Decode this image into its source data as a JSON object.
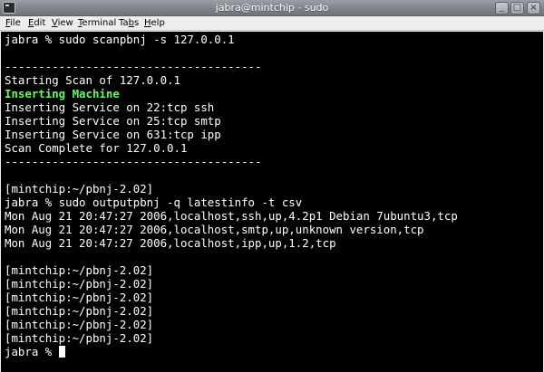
{
  "window": {
    "title": "jabra@mintchip - sudo"
  },
  "titlebar_buttons": {
    "minimize": "_",
    "maximize": "□",
    "close": "×"
  },
  "menubar": {
    "items": [
      {
        "accel": "F",
        "rest": "ile"
      },
      {
        "accel": "E",
        "rest": "dit"
      },
      {
        "accel": "V",
        "rest": "iew"
      },
      {
        "accel": "T",
        "rest": "erminal"
      },
      {
        "pre": "Ta",
        "accel": "b",
        "rest": "s"
      },
      {
        "accel": "H",
        "rest": "elp"
      }
    ]
  },
  "terminal": {
    "lines": [
      "jabra % sudo scanpbnj -s 127.0.0.1",
      "",
      "--------------------------------------",
      "Starting Scan of 127.0.0.1",
      "Inserting Machine",
      "Inserting Service on 22:tcp ssh",
      "Inserting Service on 25:tcp smtp",
      "Inserting Service on 631:tcp ipp",
      "Scan Complete for 127.0.0.1",
      "--------------------------------------",
      "",
      "[mintchip:~/pbnj-2.02]",
      "jabra % sudo outputpbnj -q latestinfo -t csv",
      "Mon Aug 21 20:47:27 2006,localhost,ssh,up,4.2p1 Debian 7ubuntu3,tcp",
      "Mon Aug 21 20:47:27 2006,localhost,smtp,up,unknown version,tcp",
      "Mon Aug 21 20:47:27 2006,localhost,ipp,up,1.2,tcp",
      "",
      "[mintchip:~/pbnj-2.02]",
      "[mintchip:~/pbnj-2.02]",
      "[mintchip:~/pbnj-2.02]",
      "[mintchip:~/pbnj-2.02]",
      "[mintchip:~/pbnj-2.02]",
      "[mintchip:~/pbnj-2.02]",
      "jabra % "
    ],
    "highlight_line_color": "#5cff5c",
    "text_color": "#ffffff",
    "background": "#000000"
  }
}
